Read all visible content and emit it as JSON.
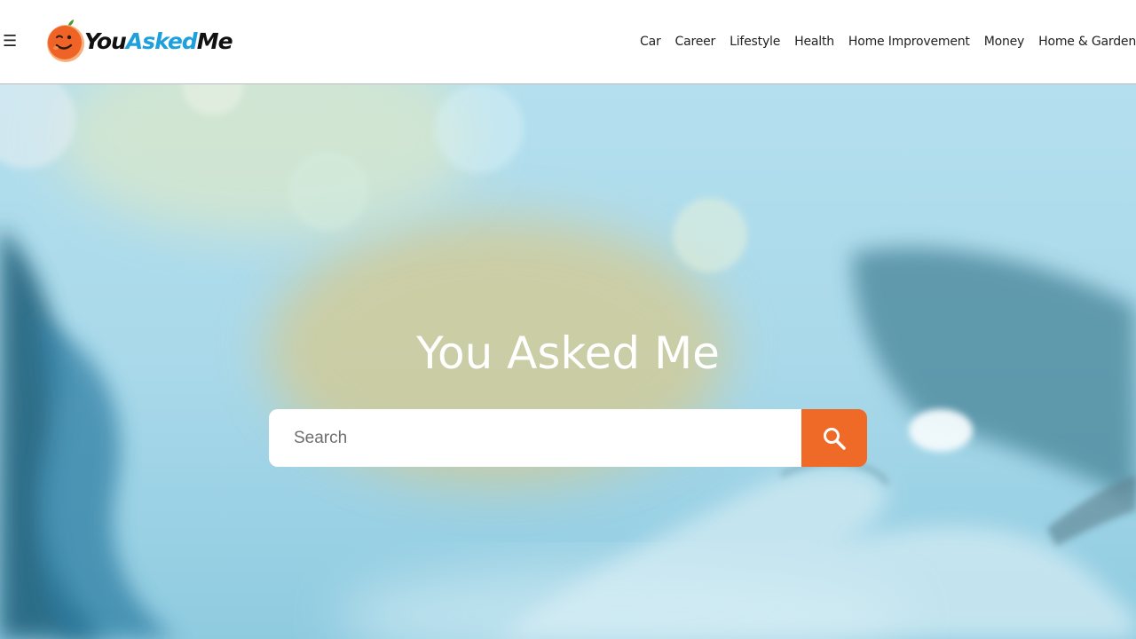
{
  "header": {
    "menu_glyph": "☰",
    "logo": {
      "part1": "You",
      "part2": "Asked",
      "part3": "Me"
    },
    "nav": [
      "Car",
      "Career",
      "Lifestyle",
      "Health",
      "Home Improvement",
      "Money",
      "Home & Garden"
    ]
  },
  "hero": {
    "title": "You Asked Me",
    "search": {
      "placeholder": "Search",
      "value": ""
    }
  },
  "colors": {
    "accent": "#ef6a26",
    "logo_blue": "#1ea0dc",
    "hero_bg": "#b4dfee",
    "title_text": "#ffffff"
  },
  "icons": {
    "menu": "hamburger-icon",
    "logo": "orange-mascot-icon",
    "search": "search-icon"
  }
}
